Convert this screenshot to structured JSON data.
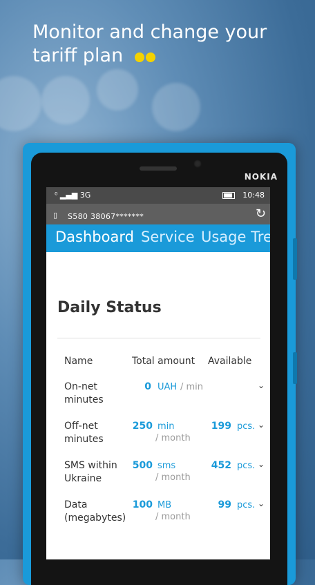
{
  "headline": "Monitor and change your tariff plan",
  "phone_brand": "NOKIA",
  "status": {
    "signal": "3G",
    "time": "10:48"
  },
  "account": {
    "number": "S580 38067*******",
    "refresh_icon": "refresh-icon"
  },
  "tabs": [
    {
      "label": "Dashboard"
    },
    {
      "label": "Service"
    },
    {
      "label": "Usage Tre"
    }
  ],
  "daily_status": {
    "title": "Daily Status",
    "headers": {
      "name": "Name",
      "total": "Total amount",
      "available": "Available"
    },
    "rows": [
      {
        "name_line1": "On-net",
        "name_line2": "minutes",
        "total_value": "0",
        "total_unit": "UAH",
        "total_per": "/ min",
        "available_value": "",
        "available_unit": ""
      },
      {
        "name_line1": "Off-net",
        "name_line2": "minutes",
        "total_value": "250",
        "total_unit": "min",
        "total_per": "/ month",
        "available_value": "199",
        "available_unit": "pcs."
      },
      {
        "name_line1": "SMS within",
        "name_line2": "Ukraine",
        "total_value": "500",
        "total_unit": "sms",
        "total_per": "/ month",
        "available_value": "452",
        "available_unit": "pcs."
      },
      {
        "name_line1": "Data",
        "name_line2": "(megabytes)",
        "total_value": "100",
        "total_unit": "MB",
        "total_per": "/ month",
        "available_value": "99",
        "available_unit": "pcs."
      }
    ]
  },
  "colors": {
    "accent": "#1a9ad9",
    "dots": "#f4d200"
  }
}
